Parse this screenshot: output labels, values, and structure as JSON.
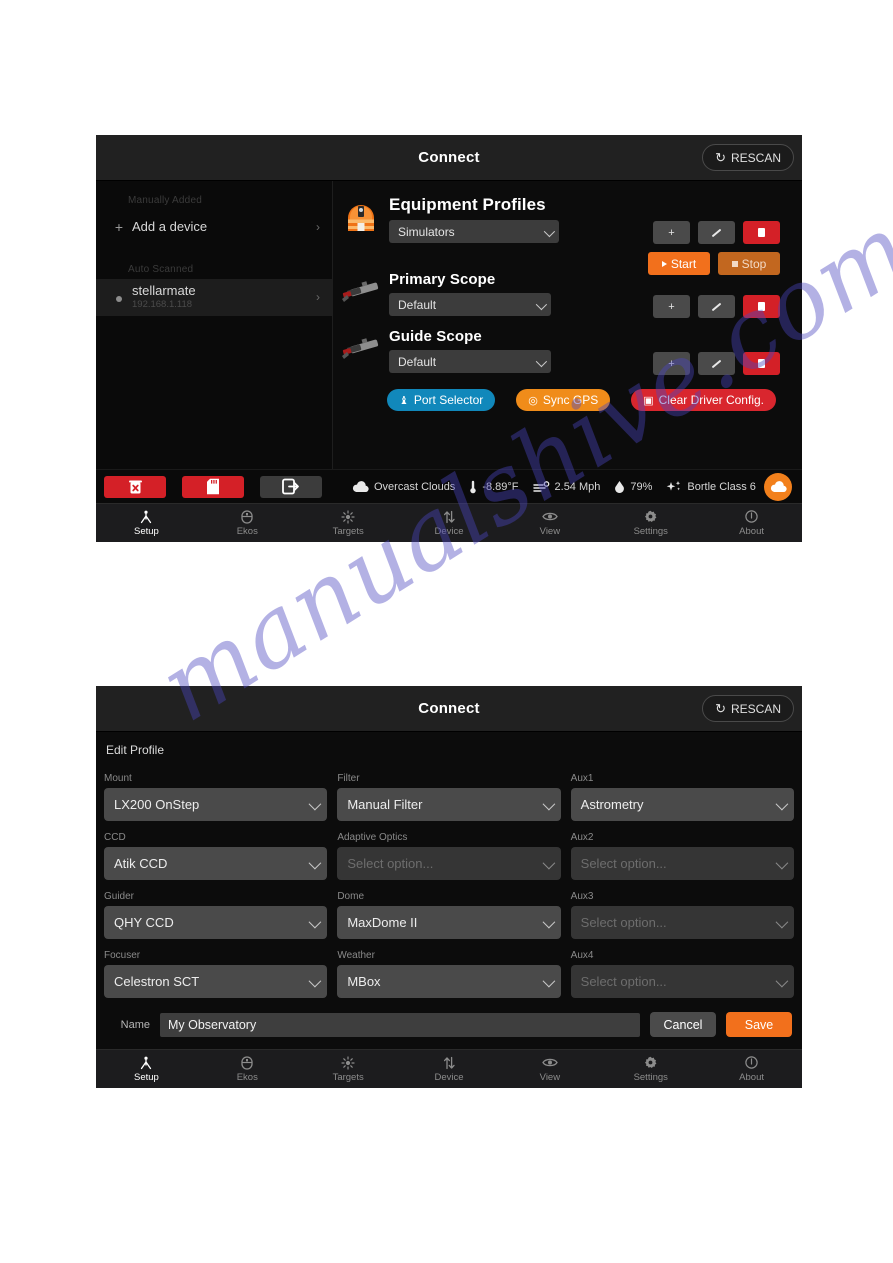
{
  "watermark": {
    "text": "manualshive.com"
  },
  "panel_top": {
    "header": {
      "title": "Connect",
      "rescan_label": "RESCAN",
      "rescan_icon": "refresh-icon"
    },
    "sidebar": {
      "groups": [
        {
          "header": "Manually Added",
          "items": [
            {
              "label": "Add a device",
              "sub": "",
              "leading_icon": "plus-icon",
              "chevron": "›",
              "selected": false
            }
          ]
        },
        {
          "header": "Auto Scanned",
          "items": [
            {
              "label": "stellarmate",
              "sub": "192.168.1.118",
              "leading_icon": "dot-icon",
              "chevron": "›",
              "selected": true
            }
          ]
        }
      ]
    },
    "sections": [
      {
        "icon": "observatory-dome-icon",
        "title": "Equipment Profiles",
        "select_value": "Simulators",
        "buttons": [
          {
            "name": "add",
            "glyph": "+",
            "style": "grey"
          },
          {
            "name": "edit",
            "glyph": "pen",
            "style": "grey"
          },
          {
            "name": "delete",
            "glyph": "trash",
            "style": "red"
          }
        ],
        "start_label": "Start",
        "stop_label": "Stop"
      },
      {
        "icon": "telescope-icon",
        "title": "Primary Scope",
        "select_value": "Default",
        "buttons": [
          {
            "name": "add",
            "glyph": "+",
            "style": "grey"
          },
          {
            "name": "edit",
            "glyph": "pen",
            "style": "grey"
          },
          {
            "name": "delete",
            "glyph": "trash",
            "style": "red"
          }
        ]
      },
      {
        "icon": "telescope-icon",
        "title": "Guide Scope",
        "select_value": "Default",
        "buttons": [
          {
            "name": "add",
            "glyph": "+",
            "style": "grey"
          },
          {
            "name": "edit",
            "glyph": "pen",
            "style": "grey"
          },
          {
            "name": "delete",
            "glyph": "trash",
            "style": "red"
          }
        ]
      }
    ],
    "pills": [
      {
        "name": "port-selector",
        "label": "Port Selector",
        "icon": "usb-icon",
        "color": "#1188bb"
      },
      {
        "name": "sync-gps",
        "label": "Sync GPS",
        "icon": "target-icon",
        "color": "#f08c1a"
      },
      {
        "name": "clear-driver",
        "label": "Clear Driver Config.",
        "icon": "eraser-icon",
        "color": "#d9262e"
      }
    ],
    "statusbar": {
      "buttons": [
        {
          "name": "delete-device-button",
          "icon": "trash-x-icon",
          "style": "red"
        },
        {
          "name": "sd-card-button",
          "icon": "sd-card-icon",
          "style": "red"
        },
        {
          "name": "logout-button",
          "icon": "logout-icon",
          "style": "grey"
        }
      ],
      "weather": [
        {
          "icon": "cloud-icon",
          "text": "Overcast Clouds"
        },
        {
          "icon": "thermometer-icon",
          "text": "-8.89°F"
        },
        {
          "icon": "wind-icon",
          "text": "2.54 Mph"
        },
        {
          "icon": "humidity-icon",
          "text": "79%"
        },
        {
          "icon": "stars-icon",
          "text": "Bortle Class 6"
        }
      ],
      "cloud_button": {
        "name": "weather-cloud-button",
        "icon": "cloud-icon",
        "color": "#f2801c"
      }
    },
    "tabs": [
      {
        "label": "Setup",
        "icon": "setup-icon",
        "active": true
      },
      {
        "label": "Ekos",
        "icon": "ekos-icon",
        "active": false
      },
      {
        "label": "Targets",
        "icon": "targets-icon",
        "active": false
      },
      {
        "label": "Device",
        "icon": "device-icon",
        "active": false
      },
      {
        "label": "View",
        "icon": "eye-icon",
        "active": false
      },
      {
        "label": "Settings",
        "icon": "gear-icon",
        "active": false
      },
      {
        "label": "About",
        "icon": "info-icon",
        "active": false
      }
    ]
  },
  "panel_bottom": {
    "header": {
      "title": "Connect",
      "rescan_label": "RESCAN",
      "rescan_icon": "refresh-icon"
    },
    "edit_title": "Edit Profile",
    "placeholder": "Select option...",
    "fields": [
      [
        {
          "label": "Mount",
          "value": "LX200 OnStep",
          "empty": false
        },
        {
          "label": "Filter",
          "value": "Manual Filter",
          "empty": false
        },
        {
          "label": "Aux1",
          "value": "Astrometry",
          "empty": false
        }
      ],
      [
        {
          "label": "CCD",
          "value": "Atik CCD",
          "empty": false
        },
        {
          "label": "Adaptive Optics",
          "value": "Select option...",
          "empty": true
        },
        {
          "label": "Aux2",
          "value": "Select option...",
          "empty": true
        }
      ],
      [
        {
          "label": "Guider",
          "value": "QHY CCD",
          "empty": false
        },
        {
          "label": "Dome",
          "value": "MaxDome II",
          "empty": false
        },
        {
          "label": "Aux3",
          "value": "Select option...",
          "empty": true
        }
      ],
      [
        {
          "label": "Focuser",
          "value": "Celestron SCT",
          "empty": false
        },
        {
          "label": "Weather",
          "value": "MBox",
          "empty": false
        },
        {
          "label": "Aux4",
          "value": "Select option...",
          "empty": true
        }
      ]
    ],
    "name_row": {
      "label": "Name",
      "value": "My Observatory",
      "cancel_label": "Cancel",
      "save_label": "Save"
    },
    "tabs": [
      {
        "label": "Setup",
        "icon": "setup-icon",
        "active": true
      },
      {
        "label": "Ekos",
        "icon": "ekos-icon",
        "active": false
      },
      {
        "label": "Targets",
        "icon": "targets-icon",
        "active": false
      },
      {
        "label": "Device",
        "icon": "device-icon",
        "active": false
      },
      {
        "label": "View",
        "icon": "eye-icon",
        "active": false
      },
      {
        "label": "Settings",
        "icon": "gear-icon",
        "active": false
      },
      {
        "label": "About",
        "icon": "info-icon",
        "active": false
      }
    ]
  }
}
